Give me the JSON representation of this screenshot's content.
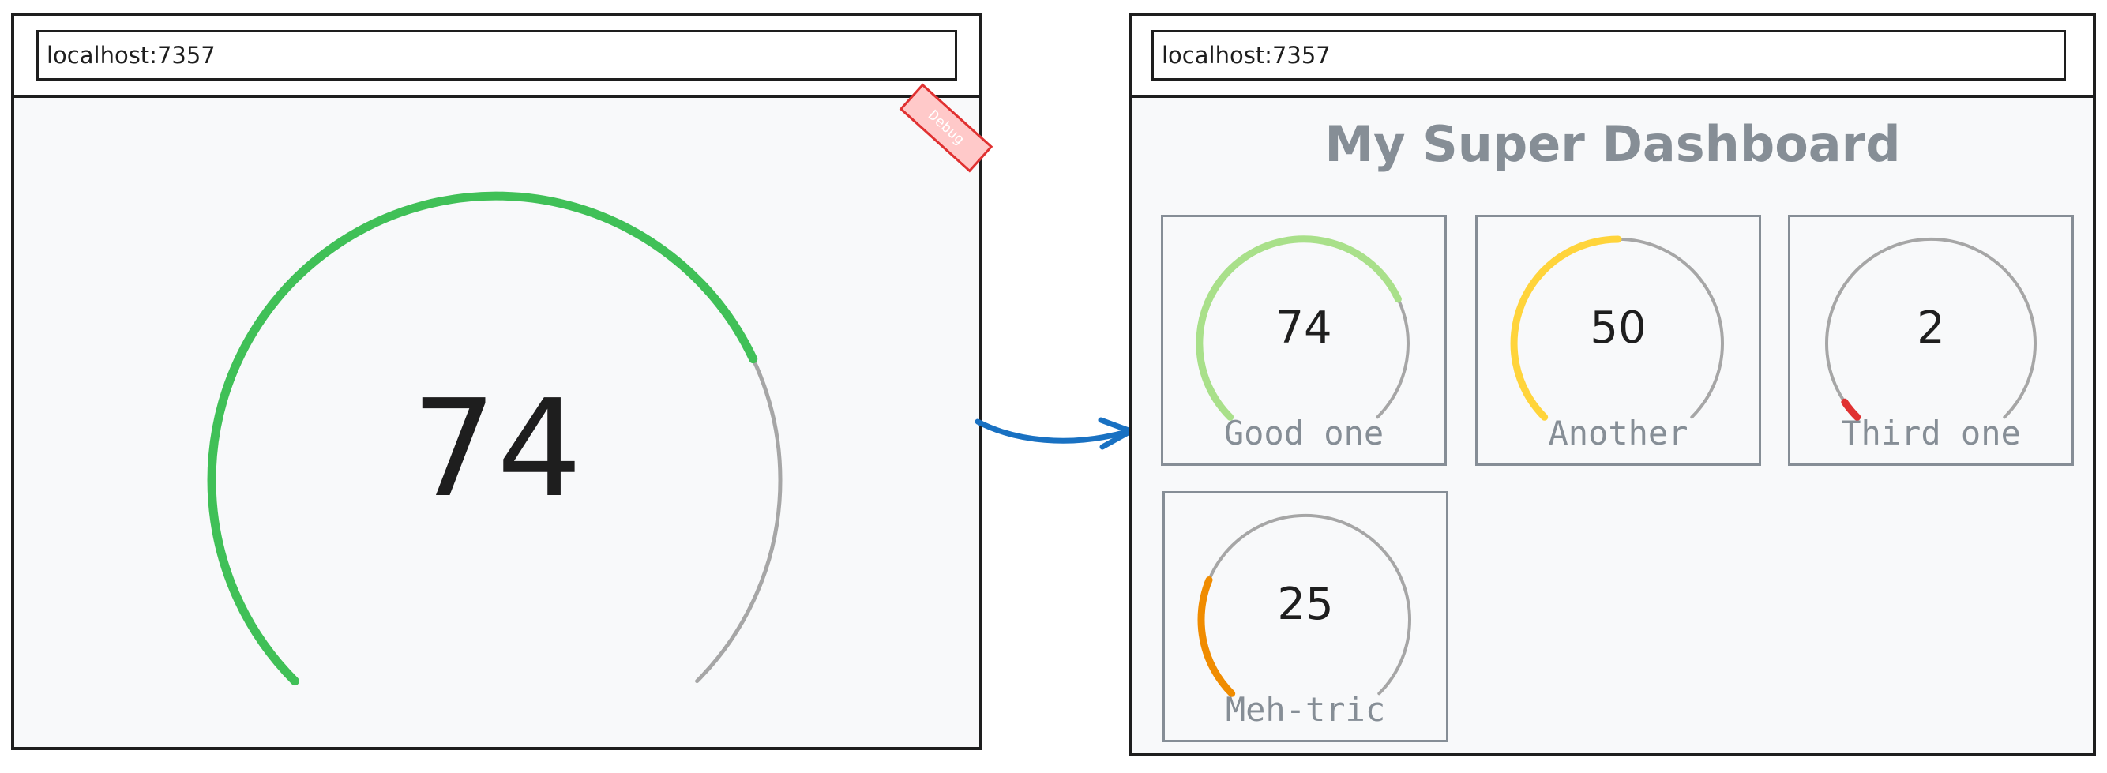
{
  "left_window": {
    "url": "localhost:7357",
    "debug_label": "Debug",
    "gauge": {
      "value": "74",
      "fraction": 0.74,
      "color": "#40c057",
      "track_color": "#a6a6a6"
    }
  },
  "right_window": {
    "url": "localhost:7357",
    "title": "My Super Dashboard",
    "track_color": "#a6a6a6",
    "cards": [
      {
        "value": "74",
        "fraction": 0.74,
        "label": "Good one",
        "color": "#a9e08a"
      },
      {
        "value": "50",
        "fraction": 0.5,
        "label": "Another",
        "color": "#ffd43b"
      },
      {
        "value": "2",
        "fraction": 0.02,
        "label": "Third one",
        "color": "#e03131"
      },
      {
        "value": "25",
        "fraction": 0.25,
        "label": "Meh-tric",
        "color": "#f08c00"
      }
    ]
  },
  "arrow_color": "#1971c2"
}
